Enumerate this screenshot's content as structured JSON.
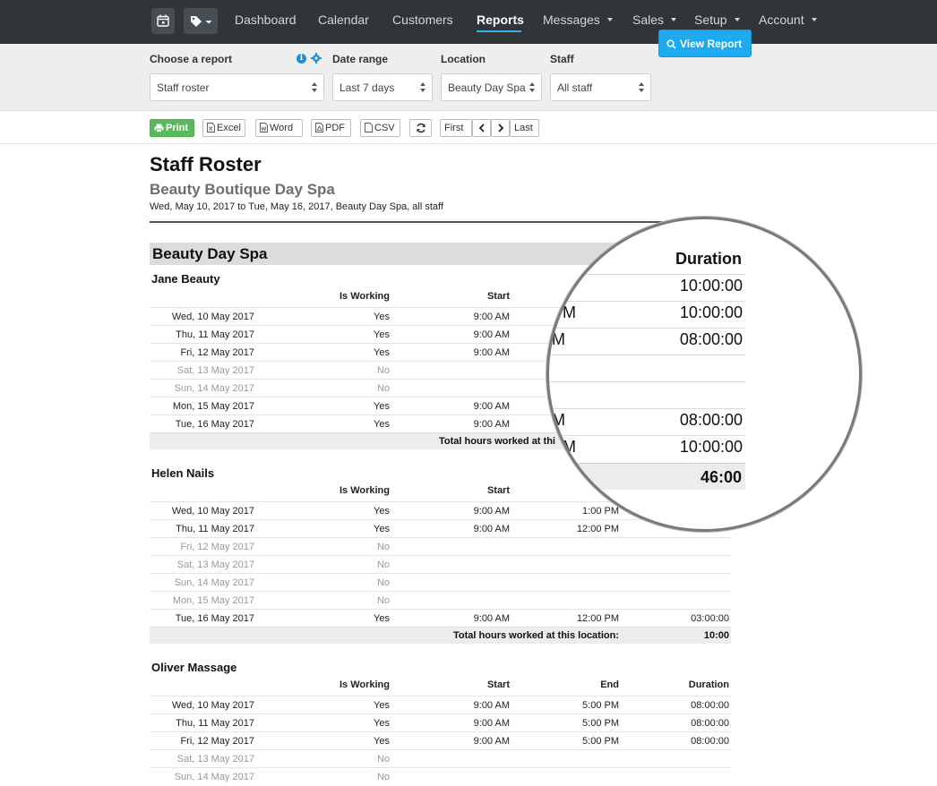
{
  "nav": {
    "items": [
      {
        "label": "Dashboard",
        "active": false,
        "dropdown": false
      },
      {
        "label": "Calendar",
        "active": false,
        "dropdown": false
      },
      {
        "label": "Customers",
        "active": false,
        "dropdown": false
      },
      {
        "label": "Reports",
        "active": true,
        "dropdown": false
      },
      {
        "label": "Messages",
        "active": false,
        "dropdown": true
      },
      {
        "label": "Sales",
        "active": false,
        "dropdown": true
      },
      {
        "label": "Setup",
        "active": false,
        "dropdown": true
      },
      {
        "label": "Account",
        "active": false,
        "dropdown": true
      }
    ],
    "icons": [
      "calendar-icon",
      "tag-icon"
    ],
    "accent": "#37b1e8"
  },
  "filters": {
    "report_label": "Choose a report",
    "report_value": "Staff roster",
    "date_label": "Date range",
    "date_value": "Last 7 days",
    "location_label": "Location",
    "location_value": "Beauty Day Spa",
    "staff_label": "Staff",
    "staff_value": "All staff",
    "view_button": "View Report",
    "info_glyph": "i"
  },
  "toolbar": {
    "print": "Print",
    "excel": "Excel",
    "word": "Word",
    "pdf": "PDF",
    "csv": "CSV",
    "first": "First",
    "last": "Last"
  },
  "report": {
    "title": "Staff Roster",
    "business": "Beauty Boutique Day Spa",
    "range": "Wed, May 10, 2017 to Tue, May 16, 2017, Beauty Day Spa, all staff",
    "location": "Beauty Day Spa",
    "columns": {
      "working": "Is Working",
      "start": "Start",
      "end": "End",
      "duration": "Duration"
    },
    "total_label": "Total hours worked at this location:",
    "staff": [
      {
        "name": "Jane Beauty",
        "rows": [
          {
            "date": "Wed, 10 May 2017",
            "working": "Yes",
            "start": "9:00 AM",
            "end": "",
            "duration": "",
            "off": false
          },
          {
            "date": "Thu, 11 May 2017",
            "working": "Yes",
            "start": "9:00 AM",
            "end": "",
            "duration": "",
            "off": false
          },
          {
            "date": "Fri, 12 May 2017",
            "working": "Yes",
            "start": "9:00 AM",
            "end": "",
            "duration": "",
            "off": false
          },
          {
            "date": "Sat, 13 May 2017",
            "working": "No",
            "start": "",
            "end": "",
            "duration": "",
            "off": true
          },
          {
            "date": "Sun, 14 May 2017",
            "working": "No",
            "start": "",
            "end": "",
            "duration": "",
            "off": true
          },
          {
            "date": "Mon, 15 May 2017",
            "working": "Yes",
            "start": "9:00 AM",
            "end": "",
            "duration": "",
            "off": false
          },
          {
            "date": "Tue, 16 May 2017",
            "working": "Yes",
            "start": "9:00 AM",
            "end": "",
            "duration": "",
            "off": false
          }
        ],
        "total_label": "Total hours worked at thi",
        "total": ""
      },
      {
        "name": "Helen Nails",
        "rows": [
          {
            "date": "Wed, 10 May 2017",
            "working": "Yes",
            "start": "9:00 AM",
            "end": "1:00 PM",
            "duration": "",
            "off": false
          },
          {
            "date": "Thu, 11 May 2017",
            "working": "Yes",
            "start": "9:00 AM",
            "end": "12:00 PM",
            "duration": "",
            "off": false
          },
          {
            "date": "Fri, 12 May 2017",
            "working": "No",
            "start": "",
            "end": "",
            "duration": "",
            "off": true
          },
          {
            "date": "Sat, 13 May 2017",
            "working": "No",
            "start": "",
            "end": "",
            "duration": "",
            "off": true
          },
          {
            "date": "Sun, 14 May 2017",
            "working": "No",
            "start": "",
            "end": "",
            "duration": "",
            "off": true
          },
          {
            "date": "Mon, 15 May 2017",
            "working": "No",
            "start": "",
            "end": "",
            "duration": "",
            "off": true
          },
          {
            "date": "Tue, 16 May 2017",
            "working": "Yes",
            "start": "9:00 AM",
            "end": "12:00 PM",
            "duration": "03:00:00",
            "off": false
          }
        ],
        "total_label": "Total hours worked at this location:",
        "total": "10:00"
      },
      {
        "name": "Oliver Massage",
        "rows": [
          {
            "date": "Wed, 10 May 2017",
            "working": "Yes",
            "start": "9:00 AM",
            "end": "5:00 PM",
            "duration": "08:00:00",
            "off": false
          },
          {
            "date": "Thu, 11 May 2017",
            "working": "Yes",
            "start": "9:00 AM",
            "end": "5:00 PM",
            "duration": "08:00:00",
            "off": false
          },
          {
            "date": "Fri, 12 May 2017",
            "working": "Yes",
            "start": "9:00 AM",
            "end": "5:00 PM",
            "duration": "08:00:00",
            "off": false
          },
          {
            "date": "Sat, 13 May 2017",
            "working": "No",
            "start": "",
            "end": "",
            "duration": "",
            "off": true
          },
          {
            "date": "Sun, 14 May 2017",
            "working": "No",
            "start": "",
            "end": "",
            "duration": "",
            "off": true
          }
        ],
        "total_label": "",
        "total": ""
      }
    ]
  },
  "magnifier": {
    "header": "Duration",
    "fragments": [
      "M",
      "PM",
      "M",
      "M",
      "PM"
    ],
    "values": [
      "10:00:00",
      "10:00:00",
      "08:00:00",
      "08:00:00",
      "10:00:00"
    ],
    "total": "46:00"
  }
}
